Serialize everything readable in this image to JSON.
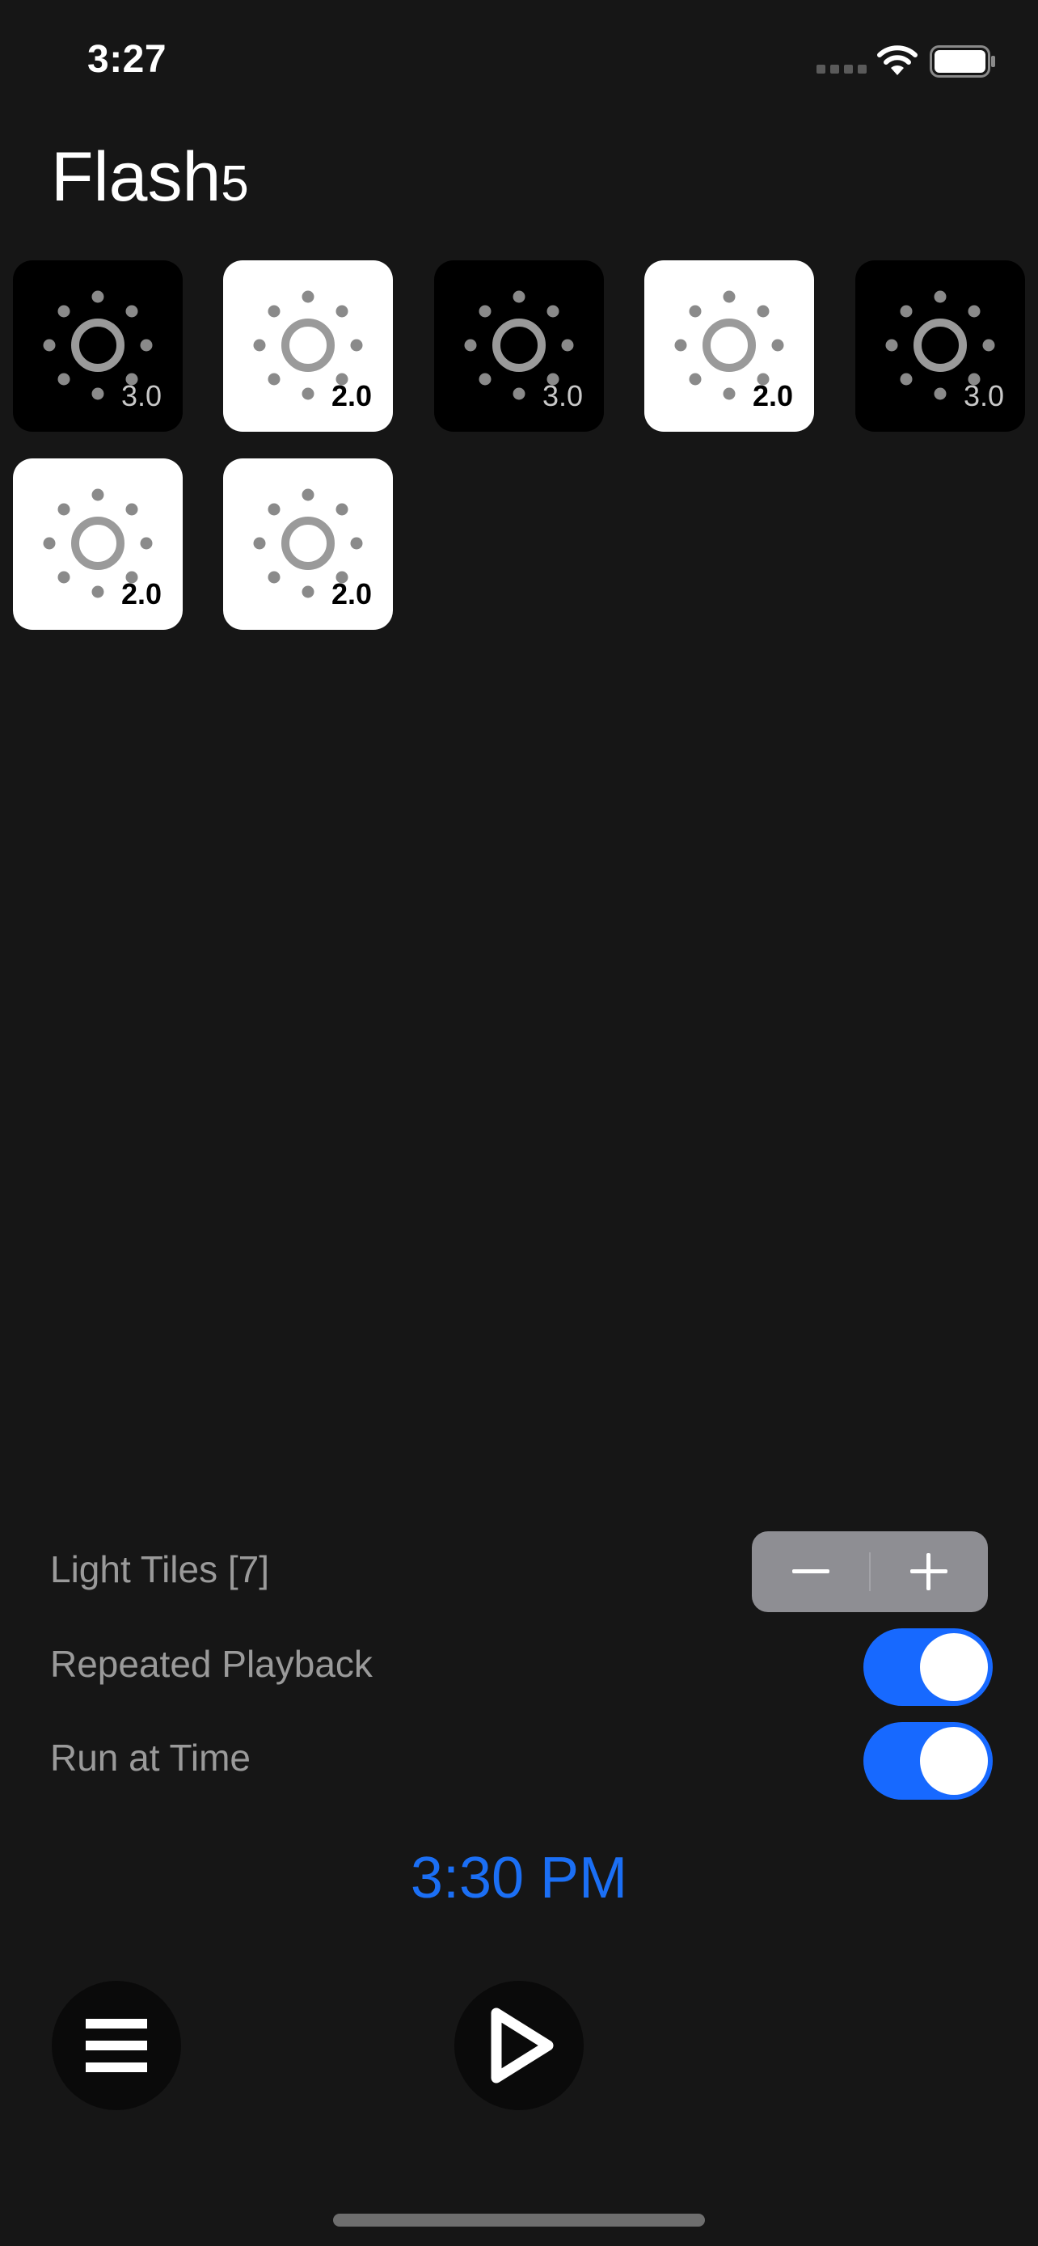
{
  "status_bar": {
    "time": "3:27"
  },
  "app": {
    "title_main": "Flash",
    "title_sub": "5"
  },
  "tiles": [
    {
      "theme": "dark",
      "value": "3.0"
    },
    {
      "theme": "light",
      "value": "2.0"
    },
    {
      "theme": "dark",
      "value": "3.0"
    },
    {
      "theme": "light",
      "value": "2.0"
    },
    {
      "theme": "dark",
      "value": "3.0"
    },
    {
      "theme": "light",
      "value": "2.0"
    },
    {
      "theme": "light",
      "value": "2.0"
    }
  ],
  "settings": {
    "light_tiles_label": "Light Tiles [7]",
    "repeated_playback_label": "Repeated Playback",
    "repeated_playback_on": true,
    "run_at_time_label": "Run at Time",
    "run_at_time_on": true,
    "run_time": "3:30 PM"
  },
  "icons": {
    "tile": "sun-icon",
    "stepper_decrement": "minus-icon",
    "stepper_increment": "plus-icon",
    "menu": "menu-icon",
    "play": "play-icon"
  },
  "colors": {
    "background": "#161616",
    "accent": "#1769ff",
    "time_text": "#1b6ff5"
  }
}
